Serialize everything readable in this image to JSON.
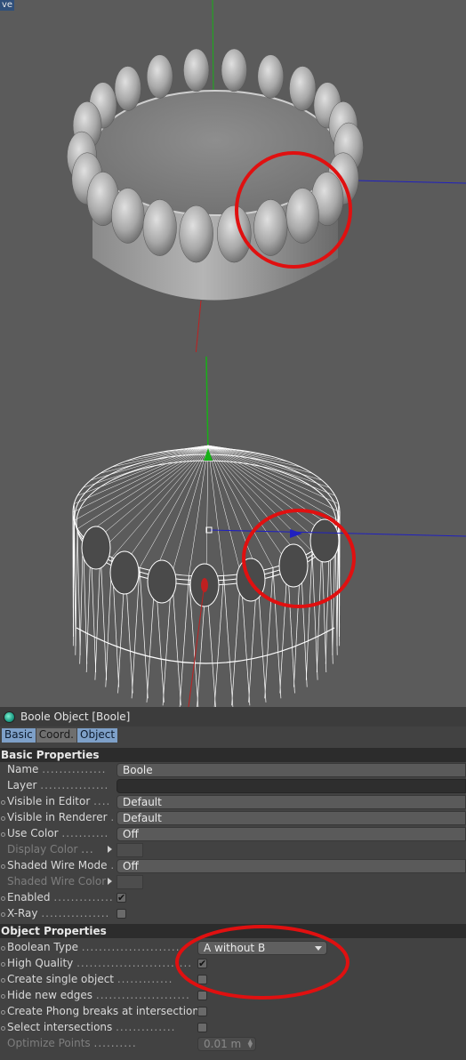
{
  "viewport": {
    "corner_label": "ve"
  },
  "object": {
    "title": "Boole Object [Boole]",
    "tabs": [
      {
        "label": "Basic",
        "active": true
      },
      {
        "label": "Coord.",
        "active": false
      },
      {
        "label": "Object",
        "active": true
      }
    ]
  },
  "basic_properties": {
    "header": "Basic Properties",
    "name_label": "Name",
    "name_value": "Boole",
    "layer_label": "Layer",
    "layer_value": "",
    "visible_editor_label": "Visible in Editor",
    "visible_editor_value": "Default",
    "visible_renderer_label": "Visible in Renderer",
    "visible_renderer_value": "Default",
    "use_color_label": "Use Color",
    "use_color_value": "Off",
    "display_color_label": "Display Color",
    "shaded_wire_mode_label": "Shaded Wire Mode",
    "shaded_wire_mode_value": "Off",
    "shaded_wire_color_label": "Shaded Wire Color",
    "enabled_label": "Enabled",
    "enabled_checked": true,
    "xray_label": "X-Ray",
    "xray_checked": false
  },
  "object_properties": {
    "header": "Object Properties",
    "boolean_type_label": "Boolean Type",
    "boolean_type_value": "A without B",
    "high_quality_label": "High Quality",
    "high_quality_checked": true,
    "create_single_label": "Create single object",
    "hide_edges_label": "Hide new edges",
    "phong_breaks_label": "Create Phong breaks at intersections",
    "select_intersections_label": "Select intersections",
    "optimize_points_label": "Optimize Points",
    "optimize_points_value": "0.01 m"
  },
  "colors": {
    "viewport_bg": "#5b5b5b",
    "panel_bg": "#424242",
    "annotation_red": "#e01010",
    "axis_green": "#18b018",
    "axis_blue": "#2020c0",
    "axis_red": "#c02020"
  }
}
